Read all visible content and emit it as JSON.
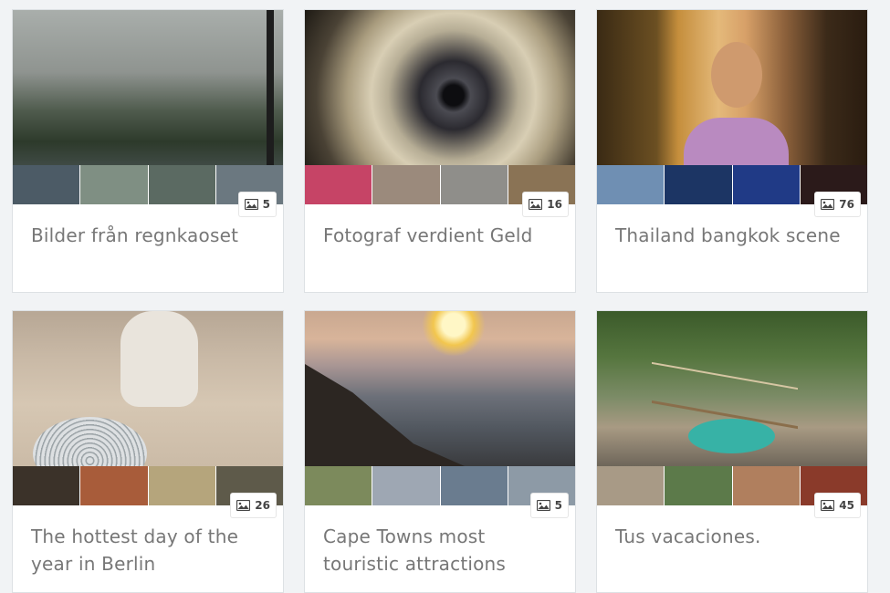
{
  "albums": [
    {
      "title": "Bilder från regnkaoset",
      "count": "5",
      "thumbs": [
        "#4c5b66",
        "#7f8f83",
        "#5b6a62",
        "#6b7880"
      ]
    },
    {
      "title": "Fotograf verdient Geld",
      "count": "16",
      "thumbs": [
        "#c64466",
        "#9b8a7c",
        "#8f8e8a",
        "#8a7355"
      ]
    },
    {
      "title": "Thailand bangkok scene",
      "count": "76",
      "thumbs": [
        "#6f8fb3",
        "#1c3564",
        "#203a86",
        "#2b1a1a"
      ]
    },
    {
      "title": "The hottest day of the year in Berlin",
      "count": "26",
      "thumbs": [
        "#3b3229",
        "#a85c3a",
        "#b5a57c",
        "#5e5a4a"
      ]
    },
    {
      "title": "Cape Towns most touristic attractions",
      "count": "5",
      "thumbs": [
        "#7c8a5c",
        "#9ea7b3",
        "#6a7c8f",
        "#8d9aa6"
      ]
    },
    {
      "title": "Tus vacaciones.",
      "count": "45",
      "thumbs": [
        "#a89a86",
        "#5c7a4a",
        "#b07f5e",
        "#8a3a2a"
      ]
    }
  ],
  "icons": {
    "badge": "image-icon"
  }
}
